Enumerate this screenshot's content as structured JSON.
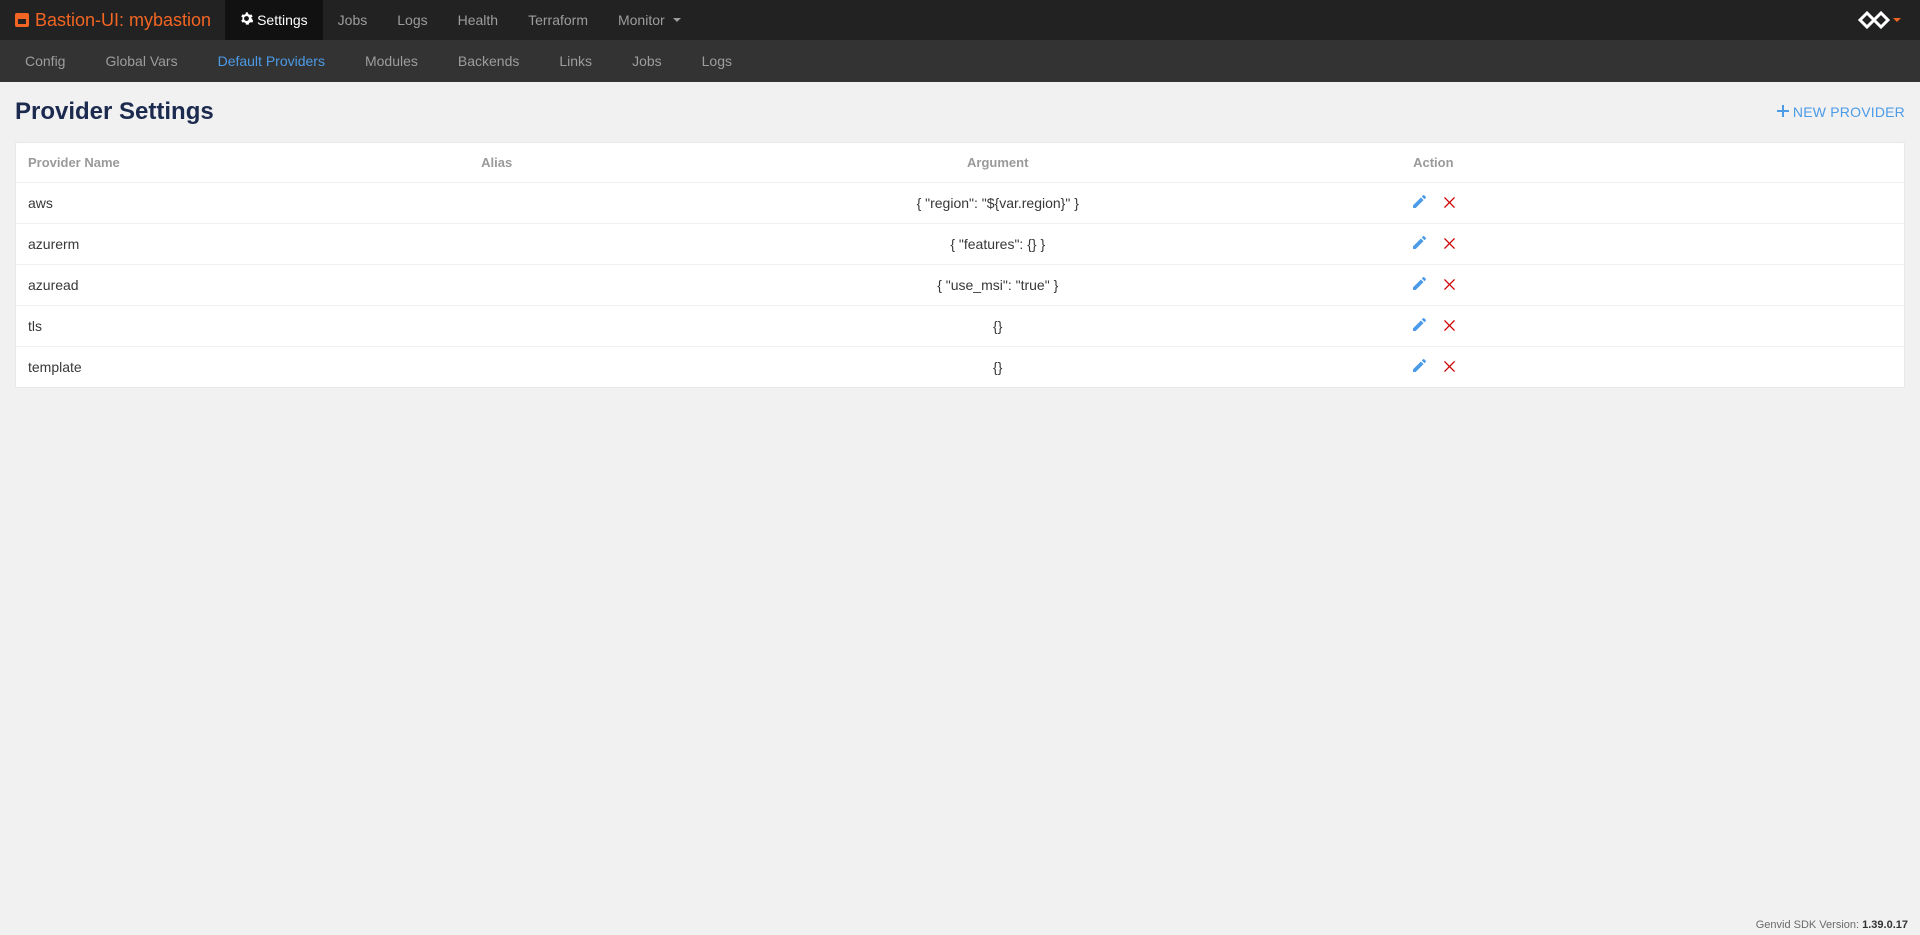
{
  "brand": {
    "label": "Bastion-UI: mybastion"
  },
  "top_nav": {
    "items": [
      {
        "label": "Settings",
        "active": true,
        "icon": "gear"
      },
      {
        "label": "Jobs",
        "active": false
      },
      {
        "label": "Logs",
        "active": false
      },
      {
        "label": "Health",
        "active": false
      },
      {
        "label": "Terraform",
        "active": false
      },
      {
        "label": "Monitor",
        "active": false,
        "dropdown": true
      }
    ]
  },
  "sub_nav": {
    "items": [
      {
        "label": "Config",
        "active": false
      },
      {
        "label": "Global Vars",
        "active": false
      },
      {
        "label": "Default Providers",
        "active": true
      },
      {
        "label": "Modules",
        "active": false
      },
      {
        "label": "Backends",
        "active": false
      },
      {
        "label": "Links",
        "active": false
      },
      {
        "label": "Jobs",
        "active": false
      },
      {
        "label": "Logs",
        "active": false
      }
    ]
  },
  "page": {
    "title": "Provider Settings",
    "new_button": "NEW PROVIDER"
  },
  "table": {
    "headers": {
      "name": "Provider Name",
      "alias": "Alias",
      "argument": "Argument",
      "action": "Action"
    },
    "rows": [
      {
        "name": "aws",
        "alias": "",
        "argument": "{ \"region\": \"${var.region}\" }"
      },
      {
        "name": "azurerm",
        "alias": "",
        "argument": "{ \"features\": {} }"
      },
      {
        "name": "azuread",
        "alias": "",
        "argument": "{ \"use_msi\": \"true\" }"
      },
      {
        "name": "tls",
        "alias": "",
        "argument": "{}"
      },
      {
        "name": "template",
        "alias": "",
        "argument": "{}"
      }
    ]
  },
  "footer": {
    "label": "Genvid SDK Version:",
    "version": "1.39.0.17"
  }
}
